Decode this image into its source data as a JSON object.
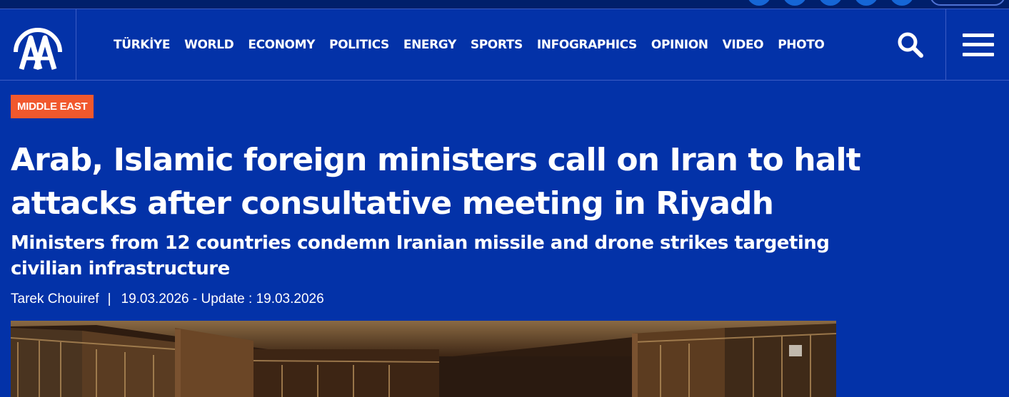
{
  "brand": {
    "logo_text": "AA"
  },
  "nav": {
    "items": [
      {
        "label": "TÜRKİYE"
      },
      {
        "label": "WORLD"
      },
      {
        "label": "ECONOMY"
      },
      {
        "label": "POLITICS"
      },
      {
        "label": "ENERGY"
      },
      {
        "label": "SPORTS"
      },
      {
        "label": "INFOGRAPHICS"
      },
      {
        "label": "OPINION"
      },
      {
        "label": "VIDEO"
      },
      {
        "label": "PHOTO"
      }
    ],
    "search_icon": "search-icon",
    "menu_icon": "hamburger-menu-icon"
  },
  "article": {
    "category": "MIDDLE EAST",
    "title": "Arab, Islamic foreign ministers call on Iran to halt attacks after consultative meeting in Riyadh",
    "subtitle": "Ministers from 12 countries condemn Iranian missile and drone strikes targeting civilian infrastructure",
    "author": "Tarek Chouiref",
    "separator": "|",
    "dateline": "19.03.2026 - Update : 19.03.2026"
  },
  "colors": {
    "background": "#0332a8",
    "topbar": "#001f6b",
    "category_badge": "#f1582d",
    "divider": "#3c5cc4",
    "text": "#ffffff"
  }
}
